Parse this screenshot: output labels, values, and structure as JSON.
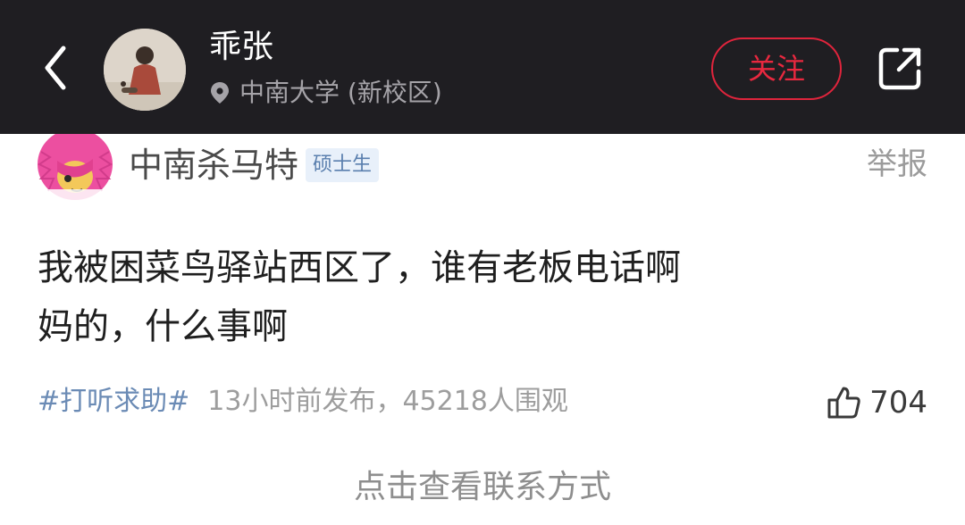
{
  "header": {
    "back_icon": "chevron-left-icon",
    "user_name": "乖张",
    "location_icon": "location-pin-icon",
    "location": "中南大学 (新校区)",
    "follow_label": "关注",
    "share_icon": "share-external-icon",
    "colors": {
      "background": "#1f1e22",
      "follow_accent": "#e0243c"
    }
  },
  "post": {
    "author": "中南杀马特",
    "badge": "硕士生",
    "report_label": "举报",
    "content_lines": [
      "我被困菜鸟驿站西区了，谁有老板电话啊",
      "妈的，什么事啊"
    ],
    "hashtag": "#打听求助#",
    "meta": "13小时前发布，45218人围观",
    "like_icon": "thumbs-up-icon",
    "like_count": "704",
    "contact_label": "点击查看联系方式",
    "colors": {
      "hashtag": "#6b8bb5",
      "badge_bg": "#e8f0fa"
    }
  }
}
